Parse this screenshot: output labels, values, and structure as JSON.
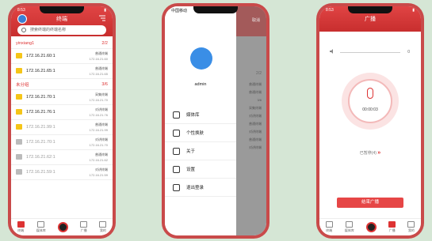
{
  "phone1": {
    "status_time": "8:53",
    "title": "终端",
    "search_placeholder": "搜索终端的终端名称",
    "groups": [
      {
        "name": "yinxiang1",
        "count": "2/2",
        "rows": [
          {
            "name": "172.16.21.60:1",
            "type": "普通终端",
            "ip": "172.16.21.60",
            "online": true,
            "color": "#f5c518"
          },
          {
            "name": "172.16.21.65:1",
            "type": "普通终端",
            "ip": "172.16.21.65",
            "online": true,
            "color": "#f5c518"
          }
        ]
      },
      {
        "name": "未分组",
        "count": "3/6",
        "rows": [
          {
            "name": "172.16.21.70:1",
            "type": "采集终端",
            "ip": "172.16.21.70",
            "online": true,
            "color": "#f5c518"
          },
          {
            "name": "172.16.21.76:1",
            "type": "对讲终端",
            "ip": "172.16.21.76",
            "online": true,
            "color": "#f5c518"
          },
          {
            "name": "172.16.21.99:1",
            "type": "普通终端",
            "ip": "172.16.21.99",
            "online": false,
            "color": "#f5c518"
          },
          {
            "name": "172.16.21.70:1",
            "type": "对讲终端",
            "ip": "172.16.21.70",
            "online": false,
            "color": "#bbbbbb"
          },
          {
            "name": "172.16.21.62:1",
            "type": "普通终端",
            "ip": "172.16.21.62",
            "online": false,
            "color": "#bbbbbb"
          },
          {
            "name": "172.16.21.59:1",
            "type": "对讲终端",
            "ip": "172.16.21.59",
            "online": false,
            "color": "#bbbbbb"
          }
        ]
      }
    ],
    "tabs": [
      "终端",
      "媒体库",
      "",
      "广播",
      "我的"
    ]
  },
  "phone2": {
    "status_time": "中国移动",
    "user": "admin",
    "menu": [
      {
        "label": "媒体库",
        "icon": "media-icon"
      },
      {
        "label": "个性换肤",
        "icon": "shirt-icon"
      },
      {
        "label": "关于",
        "icon": "info-icon"
      },
      {
        "label": "设置",
        "icon": "gear-icon"
      },
      {
        "label": "退出登录",
        "icon": "logout-icon"
      }
    ],
    "shade_header": "取消",
    "shade_count": "2/2",
    "shade_labels": [
      "普通终端",
      "普通终端",
      "3/6",
      "采集终端",
      "对讲终端",
      "普通终端",
      "对讲终端",
      "普通终端",
      "对讲终端"
    ]
  },
  "phone3": {
    "status_time": "8:53",
    "title": "广播",
    "volume": "0",
    "timer": "00:00:03",
    "stopped_label": "已暂停(4)",
    "button_label": "结束广播",
    "tabs": [
      "终端",
      "媒体库",
      "",
      "广播",
      "我的"
    ]
  },
  "colors": {
    "accent": "#d33333",
    "phone_frame": "#c94a4a",
    "background": "#d5e6d5"
  }
}
